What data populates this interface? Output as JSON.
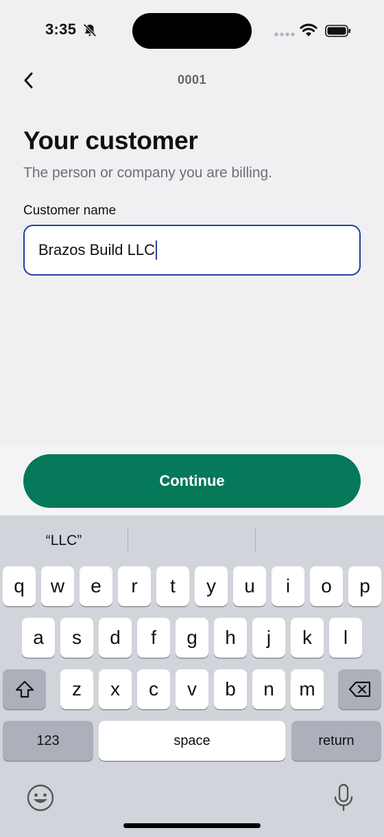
{
  "status": {
    "time": "3:35"
  },
  "nav": {
    "title": "0001"
  },
  "content": {
    "title": "Your customer",
    "subtitle": "The person or company you are billing.",
    "field_label": "Customer name",
    "field_value": "Brazos Build LLC"
  },
  "actions": {
    "continue_label": "Continue"
  },
  "keyboard": {
    "suggestions": [
      "“LLC”",
      "",
      ""
    ],
    "row1": [
      "q",
      "w",
      "e",
      "r",
      "t",
      "y",
      "u",
      "i",
      "o",
      "p"
    ],
    "row2": [
      "a",
      "s",
      "d",
      "f",
      "g",
      "h",
      "j",
      "k",
      "l"
    ],
    "row3": [
      "z",
      "x",
      "c",
      "v",
      "b",
      "n",
      "m"
    ],
    "numbers_label": "123",
    "space_label": "space",
    "return_label": "return"
  },
  "icons": {
    "silent": "bell-slash-icon",
    "back": "chevron-left-icon",
    "shift": "shift-icon",
    "delete": "backspace-icon",
    "emoji": "emoji-icon",
    "mic": "microphone-icon"
  },
  "colors": {
    "accent": "#06795a",
    "focus": "#1f3f9a",
    "background": "#f0f0f3"
  }
}
